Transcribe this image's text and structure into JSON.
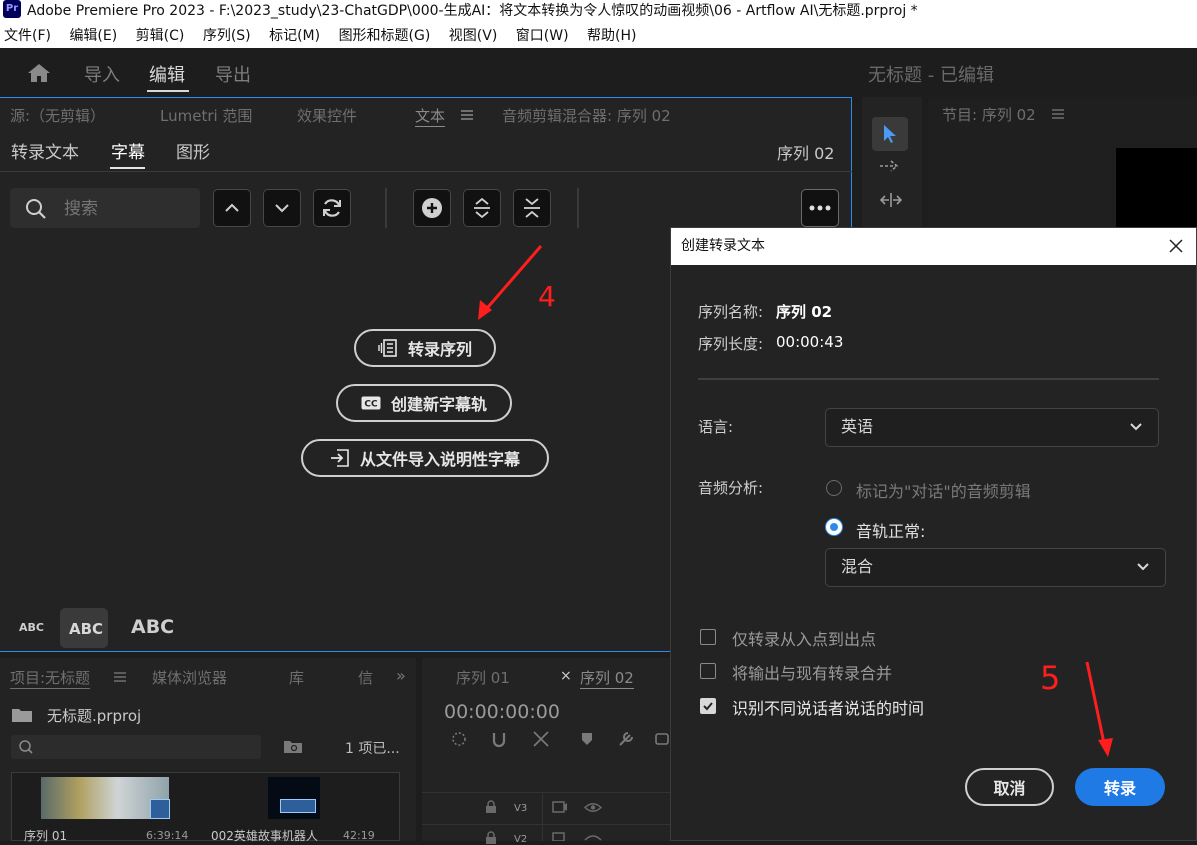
{
  "window": {
    "app_icon": "Pr",
    "title": "Adobe Premiere Pro 2023 - F:\\2023_study\\23-ChatGDP\\000-生成AI：将文本转换为令人惊叹的动画视频\\06 - Artflow AI\\无标题.prproj *"
  },
  "menu": [
    "文件(F)",
    "编辑(E)",
    "剪辑(C)",
    "序列(S)",
    "标记(M)",
    "图形和标题(G)",
    "视图(V)",
    "窗口(W)",
    "帮助(H)"
  ],
  "workspace": {
    "tabs": [
      "导入",
      "编辑",
      "导出"
    ],
    "active": "编辑",
    "project_status": "无标题 - 已编辑"
  },
  "text_panel": {
    "panel_tabs": [
      "源:（无剪辑）",
      "Lumetri 范围",
      "效果控件",
      "文本",
      "音频剪辑混合器: 序列 02"
    ],
    "active_panel_tab": "文本",
    "sub_tabs": [
      "转录文本",
      "字幕",
      "图形"
    ],
    "active_sub_tab": "字幕",
    "sequence_label": "序列 02",
    "search_placeholder": "搜索",
    "actions": {
      "transcribe": "转录序列",
      "create_caption_track": "创建新字幕轨",
      "import_captions": "从文件导入说明性字幕"
    },
    "text_sizes": [
      "ABC",
      "ABC",
      "ABC"
    ]
  },
  "program_panel": {
    "title": "节目: 序列 02"
  },
  "project_panel": {
    "tabs": [
      "项目:无标题",
      "媒体浏览器",
      "库",
      "信"
    ],
    "file": "无标题.prproj",
    "item_count": "1 项已...",
    "items": [
      {
        "name": "序列 01",
        "duration": "6:39:14"
      },
      {
        "name": "002英雄故事机器人",
        "duration": "42:19"
      }
    ]
  },
  "timeline_panel": {
    "tabs": [
      "序列 01",
      "序列 02"
    ],
    "timecode": "00:00:00:00",
    "tracks": [
      "V3",
      "V2"
    ]
  },
  "dialog": {
    "title": "创建转录文本",
    "sequence_name_label": "序列名称:",
    "sequence_name": "序列 02",
    "sequence_length_label": "序列长度:",
    "sequence_length": "00:00:43",
    "language_label": "语言:",
    "language": "英语",
    "audio_analysis_label": "音频分析:",
    "radio_dialogue": "标记为\"对话\"的音频剪辑",
    "radio_track": "音轨正常:",
    "track_mix": "混合",
    "check_in_out": "仅转录从入点到出点",
    "check_merge": "将输出与现有转录合并",
    "check_speakers": "识别不同说话者说话的时间",
    "cancel": "取消",
    "transcribe": "转录"
  },
  "annotations": {
    "step4": "4",
    "step5": "5"
  },
  "colors": {
    "accent_blue": "#1f7ae6",
    "panel_focus_border": "#2d8ceb",
    "annotation_red": "#ff1e1e"
  }
}
